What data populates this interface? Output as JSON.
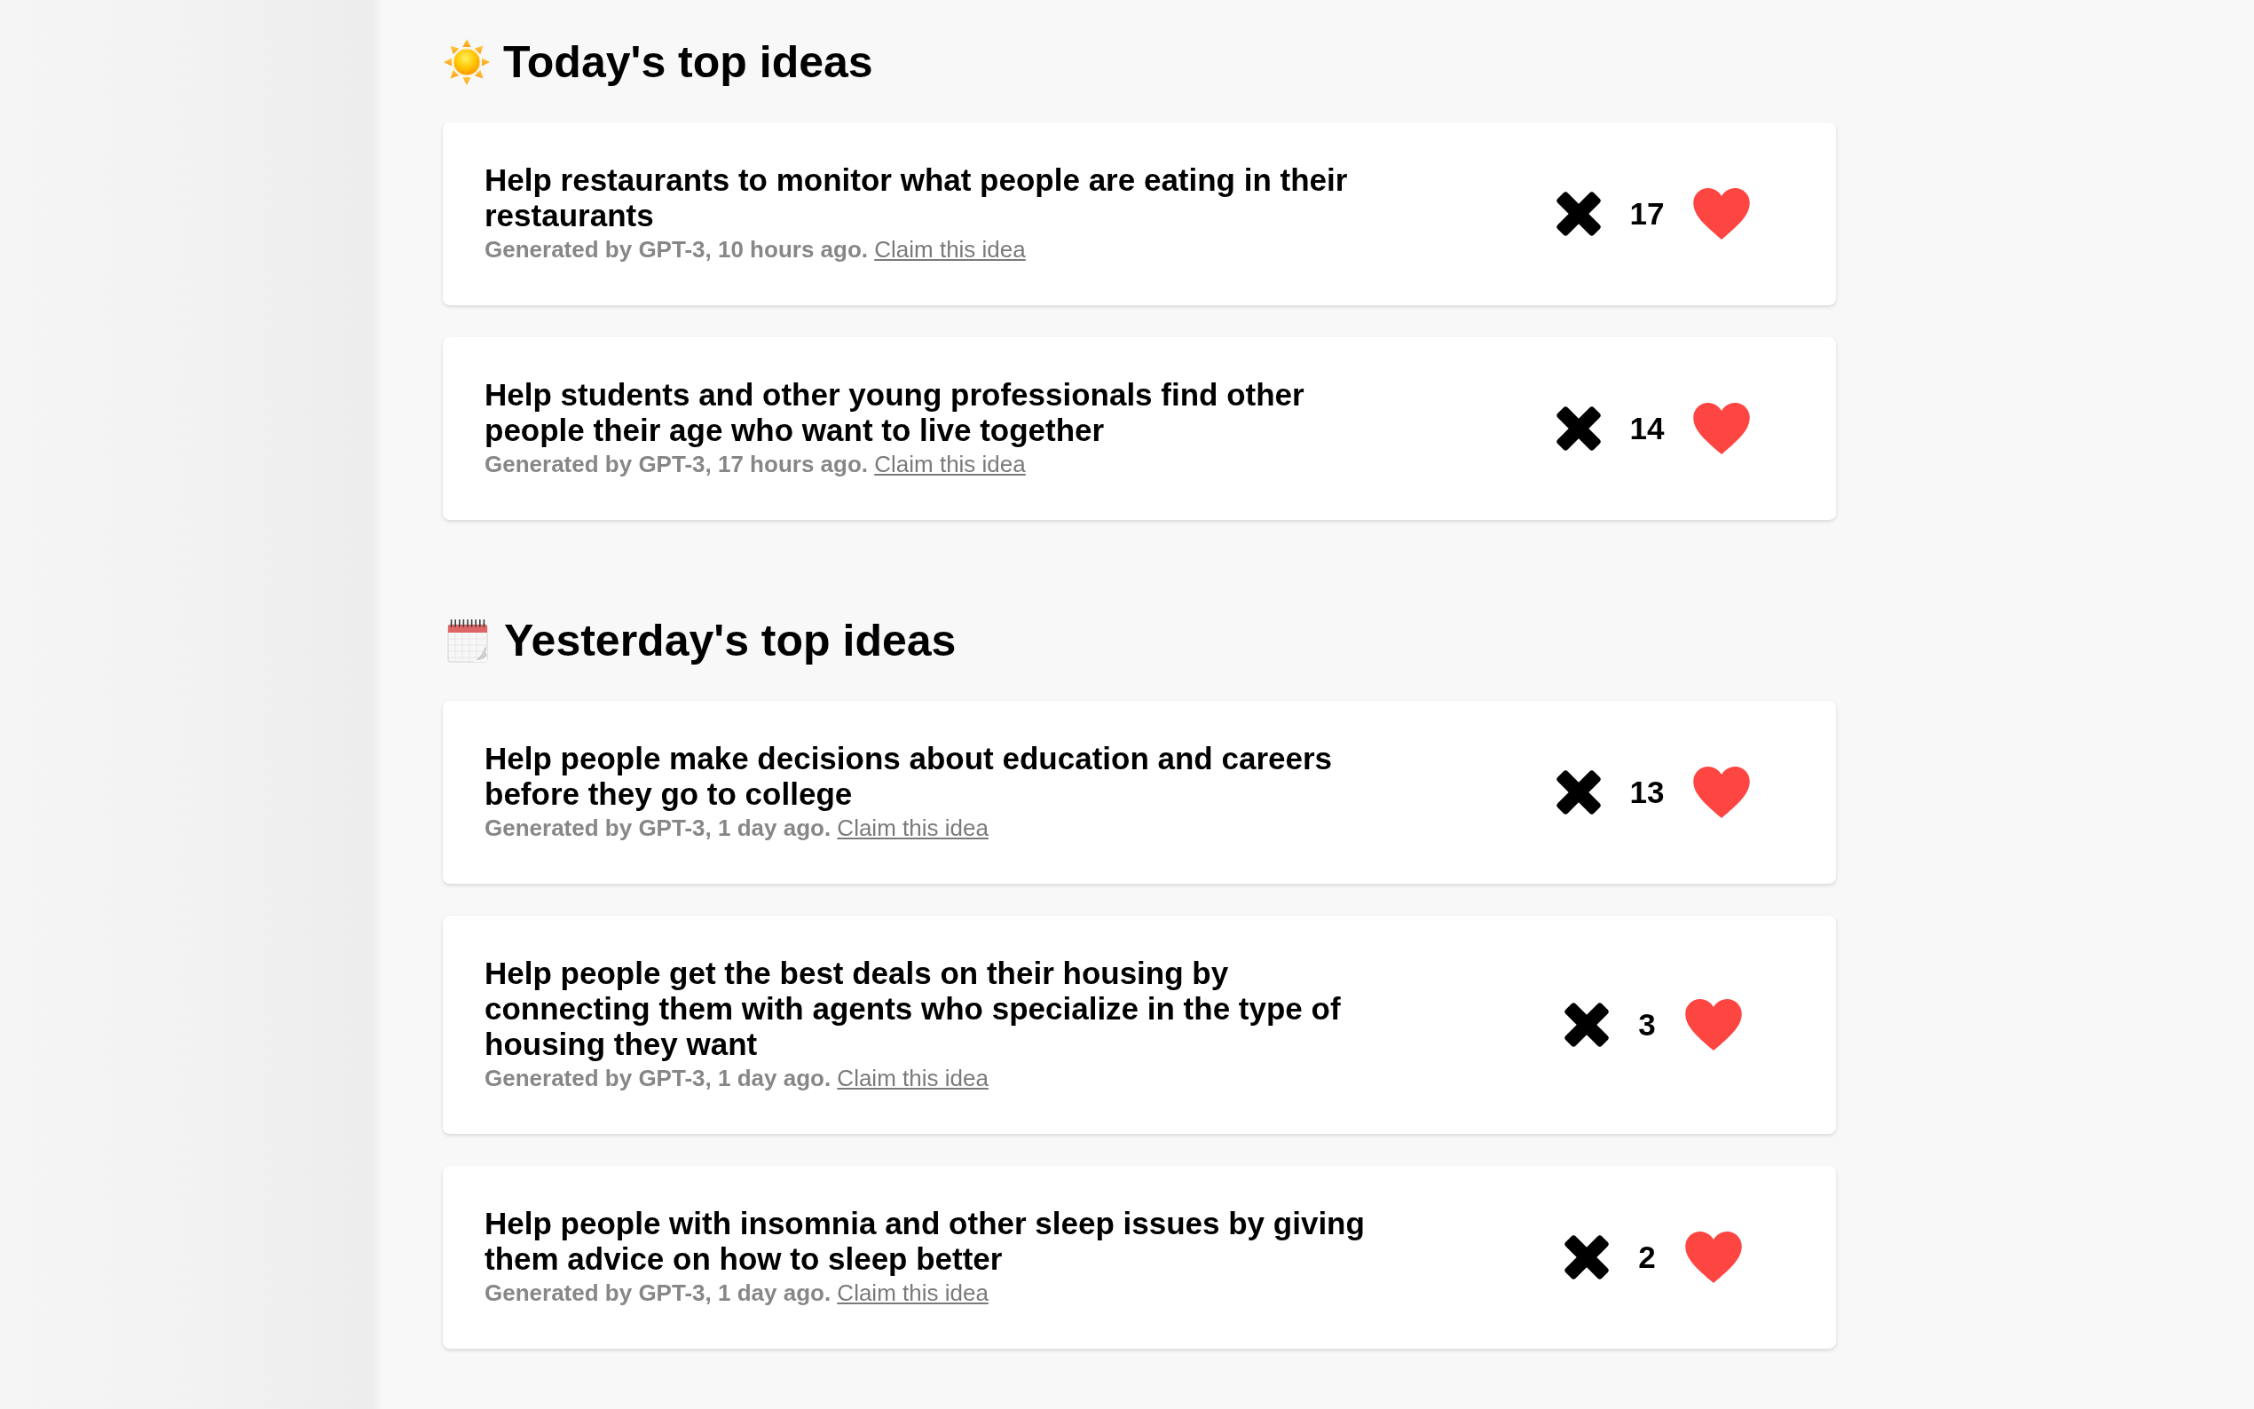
{
  "sections": [
    {
      "kind": "today",
      "title": "Today's top ideas",
      "ideas": [
        {
          "title": "Help restaurants to monitor what people are eating in their restaurants",
          "meta": "Generated by GPT-3, 10 hours ago.",
          "link": "Claim this idea",
          "votes": "17"
        },
        {
          "title": "Help students and other young professionals find other people their age who want to live together",
          "meta": "Generated by GPT-3, 17 hours ago.",
          "link": "Claim this idea",
          "votes": "14"
        }
      ]
    },
    {
      "kind": "yesterday",
      "title": "Yesterday's top ideas",
      "ideas": [
        {
          "title": "Help people make decisions about education and careers before they go to college",
          "meta": "Generated by GPT-3, 1 day ago.",
          "link": "Claim this idea",
          "votes": "13"
        },
        {
          "title": "Help people get the best deals on their housing by connecting them with agents who specialize in the type of housing they want",
          "meta": "Generated by GPT-3, 1 day ago.",
          "link": "Claim this idea",
          "votes": "3"
        },
        {
          "title": "Help people with insomnia and other sleep issues by giving them advice on how to sleep better",
          "meta": "Generated by GPT-3, 1 day ago.",
          "link": "Claim this idea",
          "votes": "2"
        }
      ]
    }
  ]
}
